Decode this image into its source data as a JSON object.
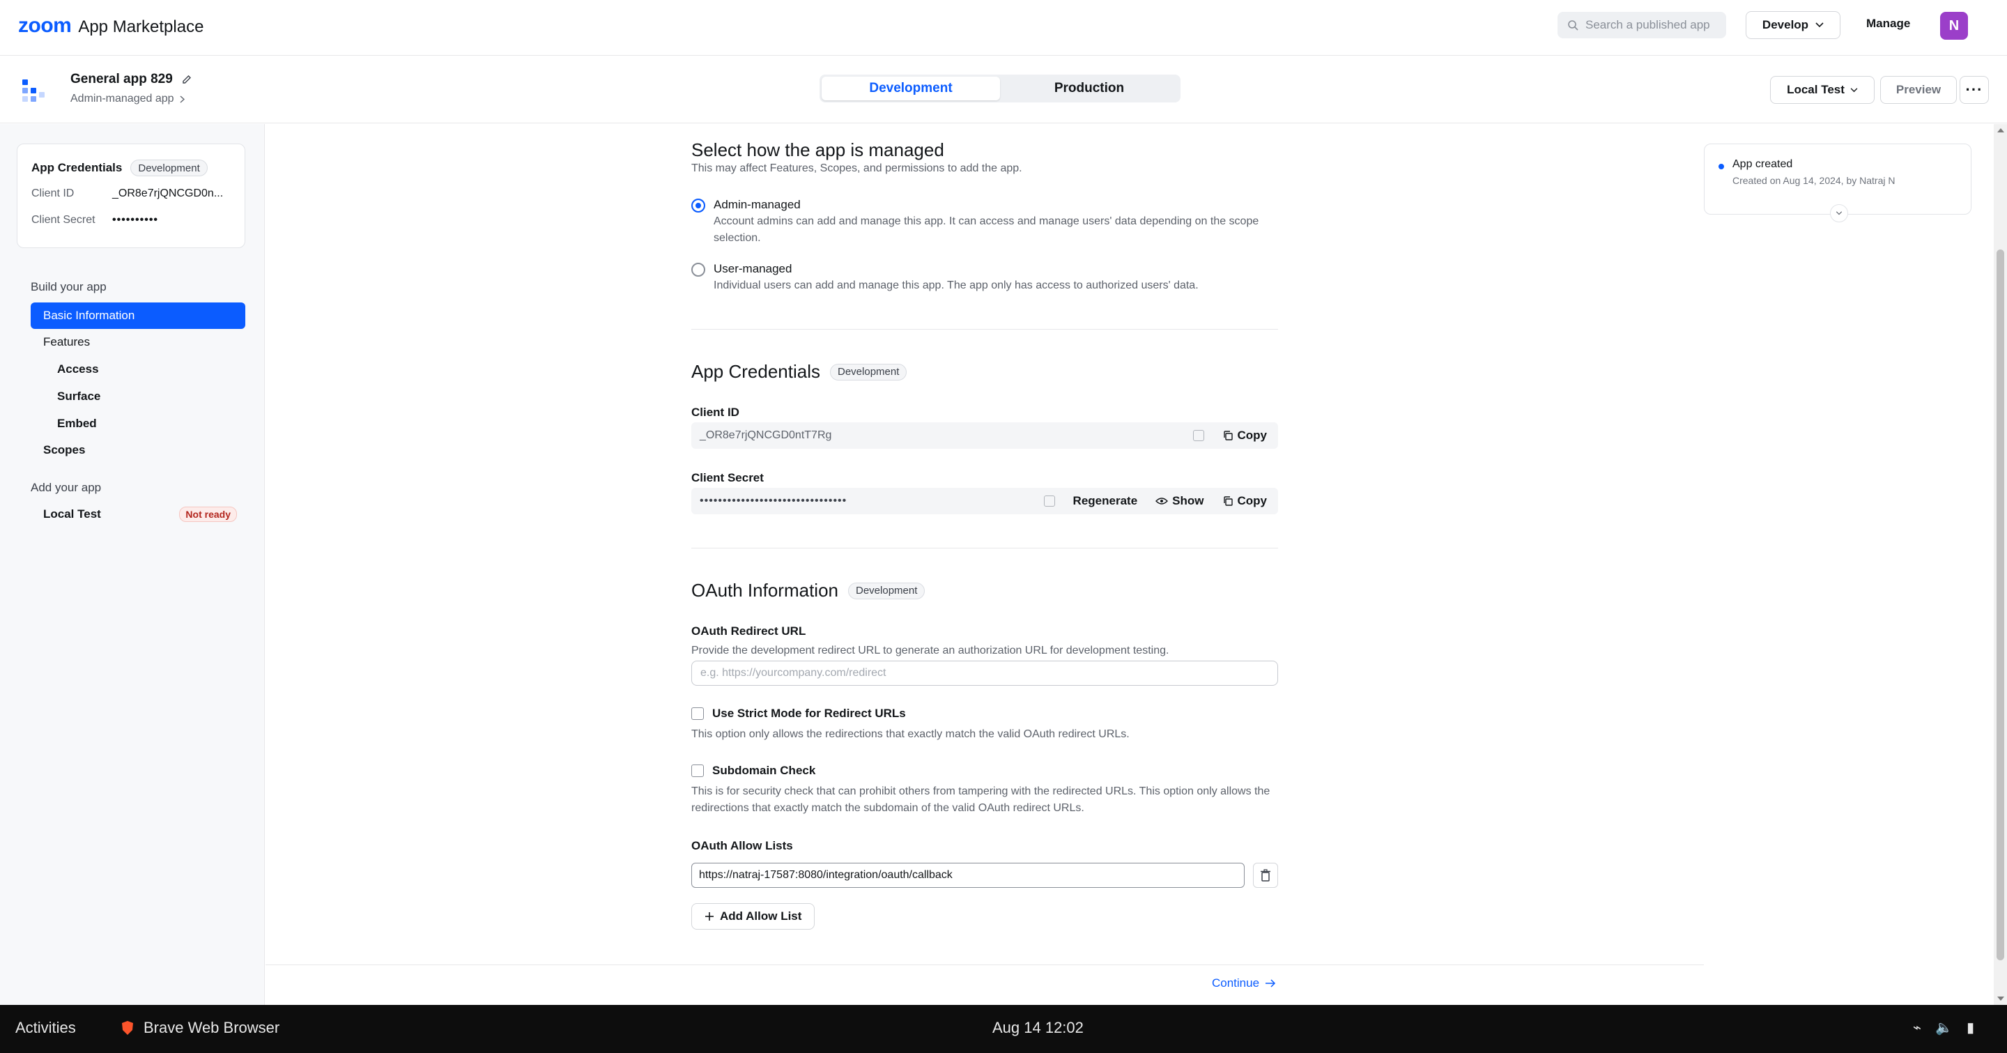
{
  "topnav": {
    "logo_brand": "zoom",
    "logo_text": "App Marketplace",
    "search_placeholder": "Search a published app",
    "develop_label": "Develop",
    "manage_label": "Manage",
    "avatar_initial": "N"
  },
  "app_header": {
    "app_name": "General app 829",
    "app_type": "Admin-managed app",
    "env_tabs": [
      "Development",
      "Production"
    ],
    "active_env": "Development",
    "local_test_label": "Local Test",
    "preview_label": "Preview",
    "more_label": "···"
  },
  "sidebar": {
    "cred_title": "App Credentials",
    "cred_badge": "Development",
    "client_id_label": "Client ID",
    "client_id_value": "_OR8e7rjQNCGD0n...",
    "client_secret_label": "Client Secret",
    "client_secret_value": "••••••••••",
    "build_section": "Build your app",
    "build_items": [
      {
        "label": "Basic Information",
        "active": true
      },
      {
        "label": "Features"
      },
      {
        "label": "Access"
      },
      {
        "label": "Surface"
      },
      {
        "label": "Embed"
      },
      {
        "label": "Scopes"
      }
    ],
    "add_section": "Add your app",
    "local_test_label": "Local Test",
    "local_test_status": "Not ready"
  },
  "main": {
    "manage_title": "Select how the app is managed",
    "manage_desc": "This may affect Features, Scopes, and permissions to add the app.",
    "admin_label": "Admin-managed",
    "admin_desc": "Account admins can add and manage this app. It can access and manage users' data depending on the scope selection.",
    "user_label": "User-managed",
    "user_desc": "Individual users can add and manage this app. The app only has access to authorized users' data.",
    "cred_title": "App Credentials",
    "cred_badge": "Development",
    "client_id_label": "Client ID",
    "client_id_value": "_OR8e7rjQNCGD0ntT7Rg",
    "copy_label": "Copy",
    "client_secret_label": "Client Secret",
    "client_secret_value": "••••••••••••••••••••••••••••••••",
    "regenerate_label": "Regenerate",
    "show_label": "Show",
    "oauth_title": "OAuth Information",
    "oauth_badge": "Development",
    "redirect_label": "OAuth Redirect URL",
    "redirect_desc": "Provide the development redirect URL to generate an authorization URL for development testing.",
    "redirect_placeholder": "e.g. https://yourcompany.com/redirect",
    "strict_label": "Use Strict Mode for Redirect URLs",
    "strict_desc": "This option only allows the redirections that exactly match the valid OAuth redirect URLs.",
    "subdomain_label": "Subdomain Check",
    "subdomain_desc": "This is for security check that can prohibit others from tampering with the redirected URLs. This option only allows the redirections that exactly match the subdomain of the valid OAuth redirect URLs.",
    "allow_label": "OAuth Allow Lists",
    "allow_value": "https://natraj-17587:8080/integration/oauth/callback",
    "add_allow_label": "Add Allow List",
    "continue_label": "Continue"
  },
  "activity": {
    "title": "App created",
    "detail": "Created on Aug 14, 2024, by Natraj N"
  },
  "taskbar": {
    "activities": "Activities",
    "app": "Brave Web Browser",
    "clock": "Aug 14  12:02"
  },
  "colors": {
    "accent": "#0b5cff",
    "avatar": "#9b3fc9"
  }
}
